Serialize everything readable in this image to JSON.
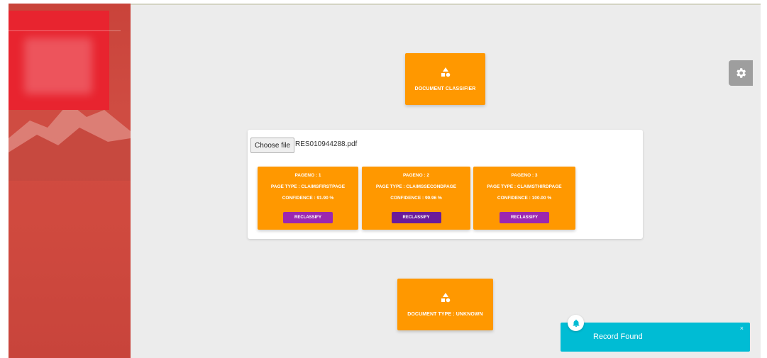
{
  "classifier_tile": {
    "label": "DOCUMENT CLASSIFIER",
    "icon": "shapes-icon"
  },
  "upload": {
    "button_label": "Choose file",
    "file_name": "RES010944288.pdf"
  },
  "pages": [
    {
      "pageno": "PAGENO : 1",
      "page_type": "PAGE TYPE : CLAIMSFIRSTPAGE",
      "confidence": "CONFIDENCE : 91.90 %",
      "action": "RECLASSIFY"
    },
    {
      "pageno": "PAGENO : 2",
      "page_type": "PAGE TYPE : CLAIMSSECONDPAGE",
      "confidence": "CONFIDENCE : 99.96 %",
      "action": "RECLASSIFY"
    },
    {
      "pageno": "PAGENO : 3",
      "page_type": "PAGE TYPE : CLAIMSTHIRDPAGE",
      "confidence": "CONFIDENCE : 100.00 %",
      "action": "RECLASSIFY"
    }
  ],
  "doctype_tile": {
    "label": "DOCUMENT TYPE : UNKNOWN",
    "icon": "shapes-icon"
  },
  "notification": {
    "text": "Record Found",
    "close": "×",
    "icon": "bell-icon"
  },
  "settings": {
    "icon": "gear-icon"
  },
  "colors": {
    "accent": "#ff9800",
    "button": "#9c27b0",
    "toast": "#00bcd4",
    "sidebar": "#d04a3f",
    "logo": "#e8242f"
  }
}
